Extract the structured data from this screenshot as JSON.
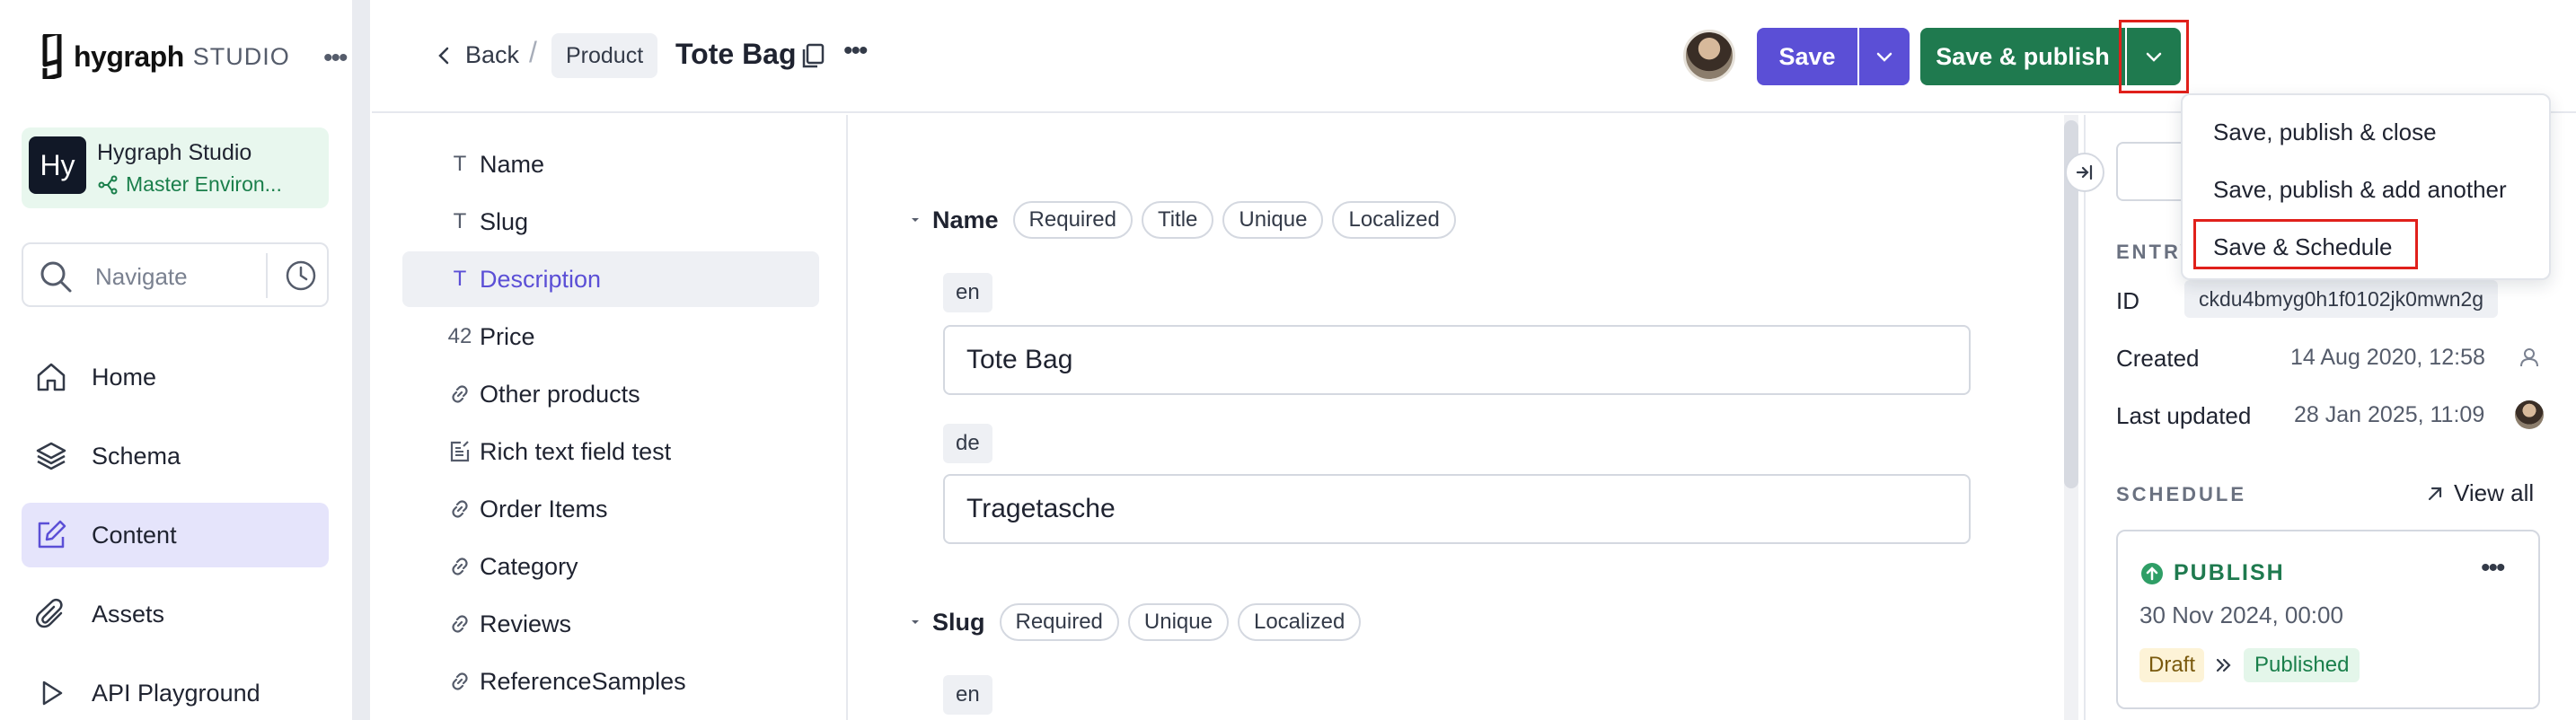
{
  "brand": {
    "name": "hygraph",
    "studio": "STUDIO"
  },
  "project": {
    "initials": "Hy",
    "name": "Hygraph Studio",
    "environment": "Master Environ..."
  },
  "navigate": {
    "label": "Navigate"
  },
  "nav": {
    "items": [
      {
        "label": "Home",
        "icon": "home-icon"
      },
      {
        "label": "Schema",
        "icon": "layers-icon"
      },
      {
        "label": "Content",
        "icon": "edit-square-icon",
        "active": true
      },
      {
        "label": "Assets",
        "icon": "paperclip-icon"
      },
      {
        "label": "API Playground",
        "icon": "play-icon"
      }
    ]
  },
  "header": {
    "back_label": "Back",
    "separator": "/",
    "model": "Product",
    "title": "Tote Bag",
    "save_label": "Save",
    "publish_label": "Save & publish"
  },
  "publish_menu": {
    "items": [
      "Save, publish & close",
      "Save, publish & add another",
      "Save & Schedule"
    ]
  },
  "fields": [
    {
      "label": "Name",
      "icon": "T"
    },
    {
      "label": "Slug",
      "icon": "T"
    },
    {
      "label": "Description",
      "icon": "T",
      "active": true
    },
    {
      "label": "Price",
      "icon": "42"
    },
    {
      "label": "Other products",
      "icon": "link-icon"
    },
    {
      "label": "Rich text field test",
      "icon": "richtext-icon"
    },
    {
      "label": "Order Items",
      "icon": "link-icon"
    },
    {
      "label": "Category",
      "icon": "link-icon"
    },
    {
      "label": "Reviews",
      "icon": "link-icon"
    },
    {
      "label": "ReferenceSamples",
      "icon": "link-icon"
    }
  ],
  "form": {
    "name_section": {
      "label": "Name",
      "tags": [
        "Required",
        "Title",
        "Unique",
        "Localized"
      ],
      "locales": [
        {
          "code": "en",
          "value": "Tote Bag"
        },
        {
          "code": "de",
          "value": "Tragetasche"
        }
      ]
    },
    "slug_section": {
      "label": "Slug",
      "tags": [
        "Required",
        "Unique",
        "Localized"
      ],
      "locale": "en"
    }
  },
  "entry": {
    "section_label": "ENTRY",
    "id_label": "ID",
    "id_value": "ckdu4bmyg0h1f0102jk0mwn2g",
    "created_label": "Created",
    "created_value": "14 Aug 2020, 12:58",
    "updated_label": "Last updated",
    "updated_value": "28 Jan 2025, 11:09"
  },
  "schedule": {
    "section_label": "SCHEDULE",
    "view_all": "View all",
    "item": {
      "action": "PUBLISH",
      "date": "30 Nov 2024, 00:00",
      "from_status": "Draft",
      "to_status": "Published"
    }
  },
  "colors": {
    "primary": "#5b4fd6",
    "publish_green": "#1f7a4f",
    "highlight_red": "#e0201b",
    "active_nav_bg": "#e5e4fb"
  }
}
